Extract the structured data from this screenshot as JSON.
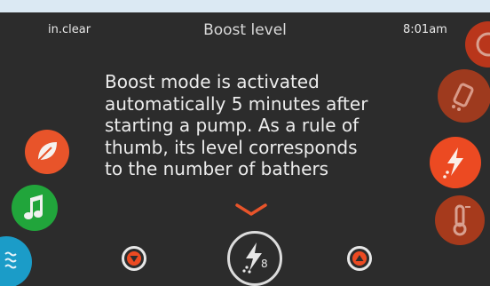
{
  "status_bar": {
    "brand": "in.clear",
    "title": "Boost level",
    "time": "8:01am"
  },
  "info_text": "Boost mode is activated\nautomatically 5 minutes after\nstarting a pump. As a rule of\nthumb, its level corresponds\nto the number of bathers",
  "boost_level": "8",
  "left_rail": [
    {
      "name": "leaf-mode-button",
      "icon": "leaf-icon",
      "color": "#e8542a"
    },
    {
      "name": "music-button",
      "icon": "music-note-icon",
      "color": "#21a53b"
    },
    {
      "name": "water-button",
      "icon": "water-waves-icon",
      "color": "#1b9cc8"
    }
  ],
  "right_rail": [
    {
      "name": "top-button",
      "icon": "partial-icon",
      "color": "#b9361b"
    },
    {
      "name": "boost-shortcut-button",
      "icon": "boost-bolt-icon",
      "color": "#9e3a1e"
    },
    {
      "name": "boost-active-button",
      "icon": "bolt-icon",
      "color": "#ec4a22"
    },
    {
      "name": "heater-button",
      "icon": "thermometer-icon",
      "color": "#a63a1c"
    }
  ],
  "colors": {
    "background": "#2c2c2c",
    "accent": "#ec4a22",
    "text": "#ececec"
  }
}
